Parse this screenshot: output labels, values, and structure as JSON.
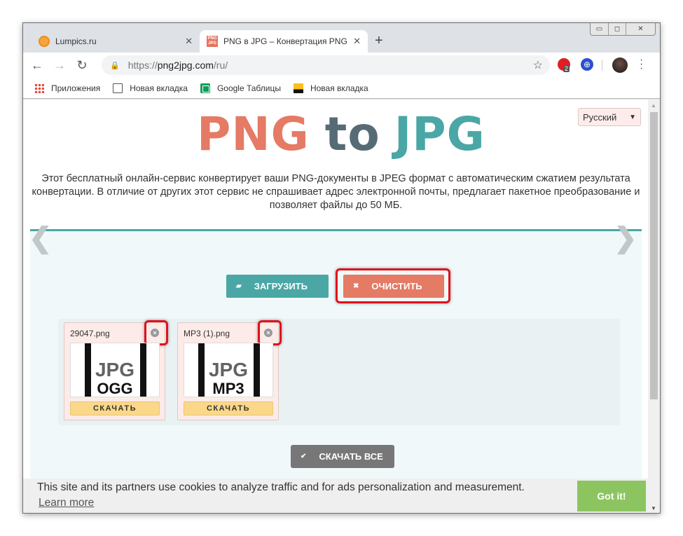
{
  "browser": {
    "tabs": [
      {
        "title": "Lumpics.ru",
        "icon": "orange-favicon",
        "active": false
      },
      {
        "title": "PNG в JPG – Конвертация PNG в JPG онлайн",
        "icon": "png2jpg-favicon",
        "active": true
      }
    ],
    "url_scheme": "https://",
    "url_host": "png2jpg.com",
    "url_path": "/ru/",
    "extension_badge": "2",
    "bookmarks": [
      {
        "label": "Приложения",
        "icon": "apps-icon"
      },
      {
        "label": "Новая вкладка",
        "icon": "page-icon"
      },
      {
        "label": "Google Таблицы",
        "icon": "sheets-icon"
      },
      {
        "label": "Новая вкладка",
        "icon": "image-icon"
      }
    ],
    "window_controls": {
      "minimize": "▭",
      "restore": "◻",
      "close": "✕"
    }
  },
  "page": {
    "language": "Русский",
    "logo": {
      "part1": "PNG",
      "part2": "to",
      "part3": "JPG"
    },
    "description": "Этот бесплатный онлайн-сервис конвертирует ваши PNG-документы в JPEG формат с автоматическим сжатием результата конвертации. В отличие от других этот сервис не спрашивает адрес электронной почты, предлагает пакетное преобразование и позволяет файлы до 50 МБ.",
    "upload_label": "ЗАГРУЗИТЬ",
    "clear_label": "ОЧИСТИТЬ",
    "download_all_label": "СКАЧАТЬ ВСЕ",
    "files": [
      {
        "name": "29047.png",
        "thumb_label": "JPG",
        "thumb_sub": "OGG",
        "download_label": "СКАЧАТЬ"
      },
      {
        "name": "MP3 (1).png",
        "thumb_label": "JPG",
        "thumb_sub": "MP3",
        "download_label": "СКАЧАТЬ"
      }
    ],
    "carousel_prev": "❮",
    "carousel_next": "❯"
  },
  "cookie_banner": {
    "message": "This site and its partners use cookies to analyze traffic and for ads personalization and measurement.",
    "learn_more": "Learn more",
    "accept": "Got it!"
  },
  "colors": {
    "brand_red": "#e57a65",
    "brand_teal": "#4aa7a6",
    "brand_slate": "#566b76",
    "highlight": "#e0111b",
    "accept_green": "#8cc560"
  }
}
